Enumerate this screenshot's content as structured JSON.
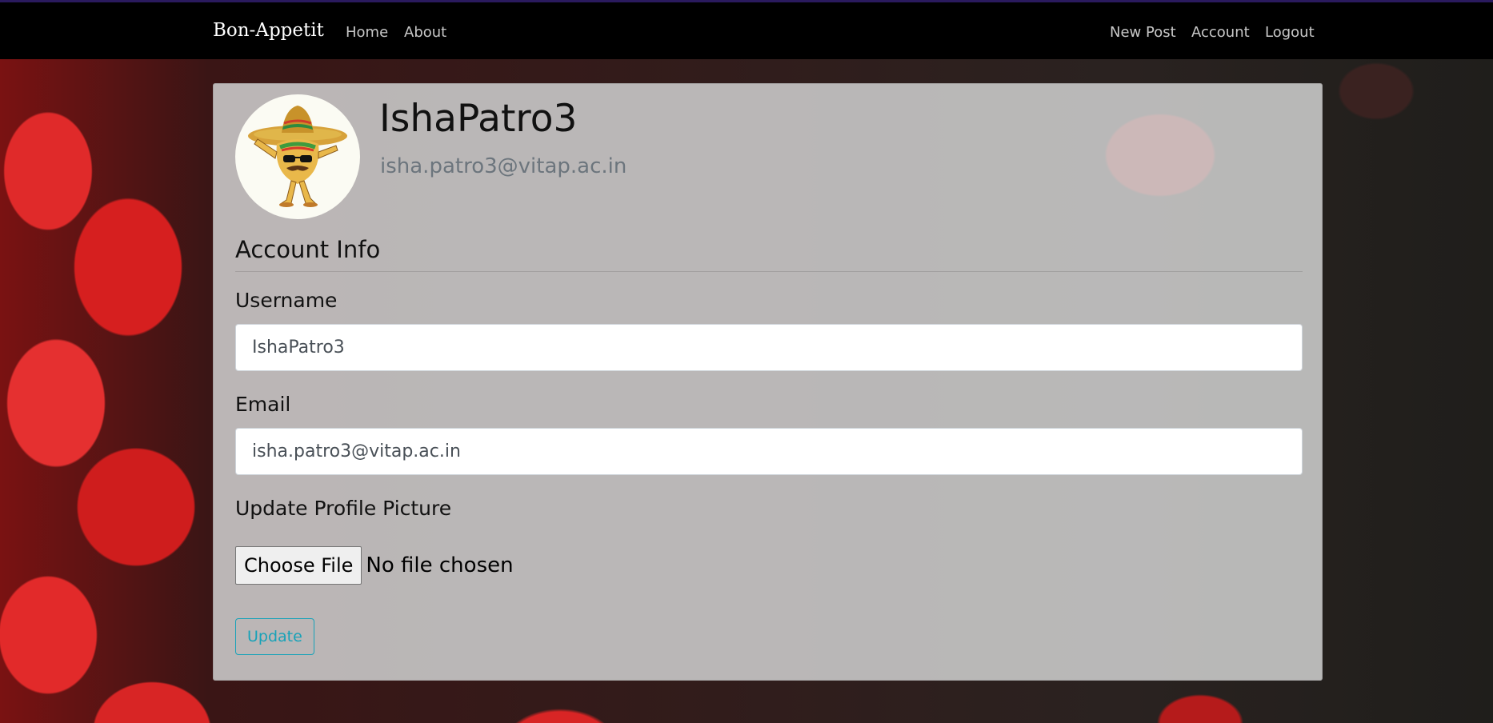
{
  "nav": {
    "brand": "Bon-Appetit",
    "left_links": [
      "Home",
      "About"
    ],
    "right_links": [
      "New Post",
      "Account",
      "Logout"
    ]
  },
  "profile": {
    "username": "IshaPatro3",
    "email": "isha.patro3@vitap.ac.in",
    "avatar_icon": "taco-sombrero-avatar-icon"
  },
  "form": {
    "legend": "Account Info",
    "username_label": "Username",
    "username_value": "IshaPatro3",
    "email_label": "Email",
    "email_value": "isha.patro3@vitap.ac.in",
    "picture_label": "Update Profile Picture",
    "file_button": "Choose File",
    "file_status": "No file chosen",
    "submit": "Update"
  },
  "colors": {
    "navbar": "#000000",
    "accent_info": "#17a2b8",
    "muted_text": "#6c757d"
  }
}
